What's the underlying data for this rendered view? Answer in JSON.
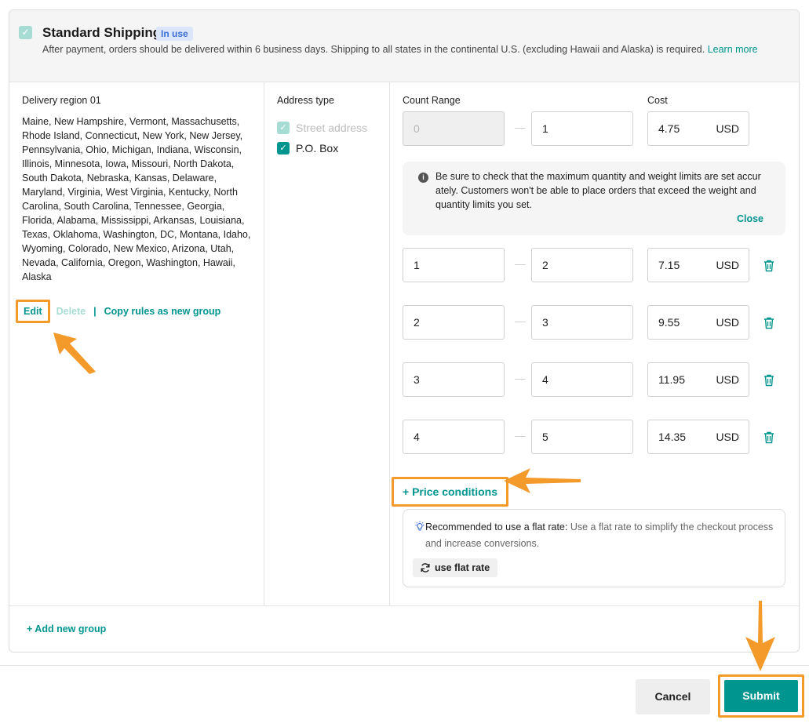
{
  "header": {
    "check_icon": "check-icon",
    "title": "Standard Shipping",
    "badge": "In use",
    "description": "After payment, orders should be delivered within 6 business days. Shipping to all states in the continental U.S. (excluding Hawaii and Alaska) is required.",
    "learn_more": "Learn more"
  },
  "region": {
    "title": "Delivery region 01",
    "states": "Maine, New Hampshire, Vermont, Massachusetts, Rhode Island, Connecticut, New York, New Jersey, Pennsylvania, Ohio, Michigan, Indiana, Wisconsin, Illinois, Minnesota, Iowa, Missouri, North Dakota, South Dakota, Nebraska, Kansas, Delaware, Maryland, Virginia, West Virginia, Kentucky, North Carolina, South Carolina, Tennessee, Georgia, Florida, Alabama, Mississippi, Arkansas, Louisiana, Texas, Oklahoma, Washington, DC, Montana, Idaho, Wyoming, Colorado, New Mexico, Arizona, Utah, Nevada, California, Oregon, Washington, Hawaii, Alaska",
    "edit": "Edit",
    "delete": "Delete",
    "separator": "|",
    "copy": "Copy rules as new group"
  },
  "address": {
    "title": "Address type",
    "options": [
      {
        "label": "Street address",
        "checked": true,
        "disabled": true
      },
      {
        "label": "P.O. Box",
        "checked": true,
        "disabled": false
      }
    ]
  },
  "ranges": {
    "count_label": "Count Range",
    "cost_label": "Cost",
    "dash": "—",
    "currency": "USD",
    "rows": [
      {
        "from": "0",
        "to": "1",
        "cost": "4.75"
      },
      {
        "from": "1",
        "to": "2",
        "cost": "7.15"
      },
      {
        "from": "2",
        "to": "3",
        "cost": "9.55"
      },
      {
        "from": "3",
        "to": "4",
        "cost": "11.95"
      },
      {
        "from": "4",
        "to": "5",
        "cost": "14.35"
      }
    ]
  },
  "notice": {
    "icon": "info-icon",
    "text": "Be sure to check that the maximum quantity and weight limits are set accur ately. Customers won't be able to place orders that exceed the weight and quantity limits you set.",
    "close": "Close"
  },
  "price_conditions": "+ Price conditions",
  "recommendation": {
    "icon": "lightbulb-icon",
    "title": "Recommended to use a flat rate:",
    "text": " Use a flat rate to simplify the checkout process and increase conversions.",
    "button": "use flat rate",
    "button_icon": "refresh-icon"
  },
  "footer": {
    "add_group": "+ Add new group",
    "cancel": "Cancel",
    "submit": "Submit"
  },
  "colors": {
    "accent": "#00958f",
    "highlight": "#f39a2b",
    "badge_bg": "#dbe6fb"
  }
}
